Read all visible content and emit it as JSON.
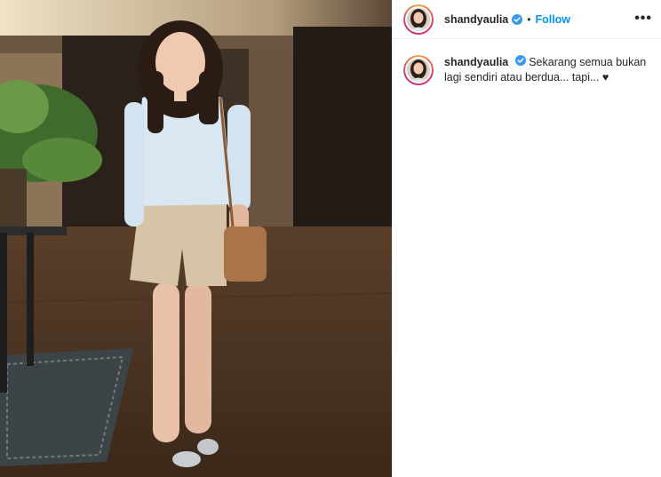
{
  "post": {
    "username": "shandyaulia",
    "follow_label": "Follow",
    "separator": "•",
    "more_label": "•••",
    "caption": "Sekarang semua bukan lagi sendiri atau berdua... tapi... ♥"
  },
  "colors": {
    "brand_blue": "#0095f6",
    "verified_blue": "#3897f0",
    "text": "#262626",
    "divider": "#efefef"
  },
  "icons": {
    "verified": "verified-badge-icon",
    "more": "more-options-icon"
  }
}
